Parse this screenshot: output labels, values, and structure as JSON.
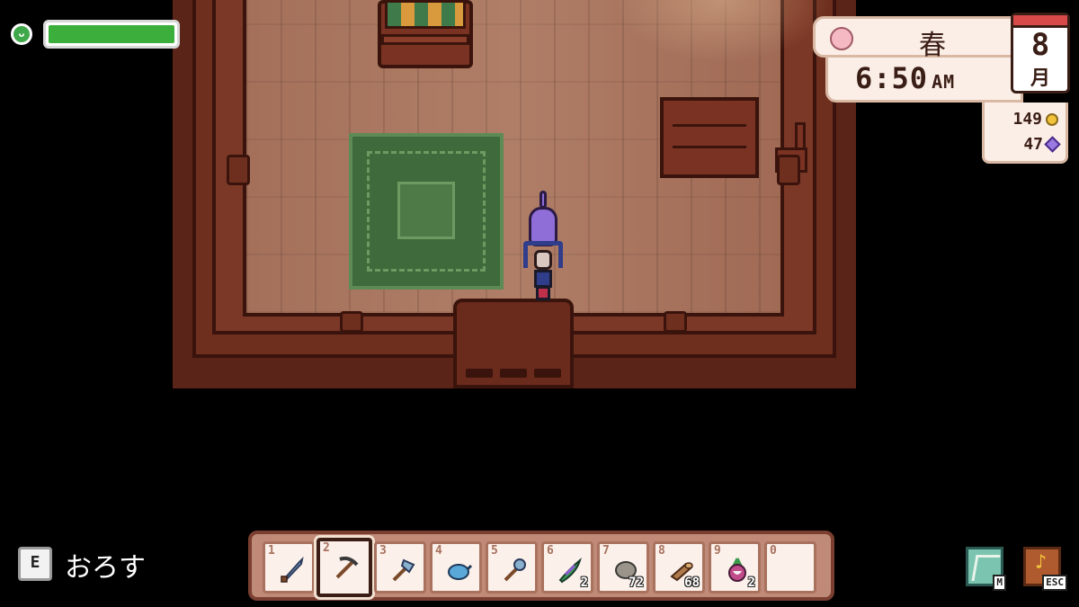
{
  "hud": {
    "health": {
      "fraction": 1.0,
      "icon": "health-icon",
      "color": "#3cae3c"
    },
    "season": "春",
    "time": {
      "clock": "6:50",
      "ampm": "AM"
    },
    "calendar": {
      "day": "8",
      "month": "月"
    },
    "currency": {
      "gold": "149",
      "gems": "47"
    },
    "action": {
      "key": "E",
      "label": "おろす"
    },
    "buttons": {
      "map_key": "M",
      "menu_key": "ESC"
    }
  },
  "hotbar": {
    "selected_index": 1,
    "slots": [
      {
        "num": "1",
        "item": "sword-icon",
        "count": ""
      },
      {
        "num": "2",
        "item": "pickaxe-icon",
        "count": ""
      },
      {
        "num": "3",
        "item": "axe-icon",
        "count": ""
      },
      {
        "num": "4",
        "item": "watering-can-icon",
        "count": ""
      },
      {
        "num": "5",
        "item": "shovel-icon",
        "count": ""
      },
      {
        "num": "6",
        "item": "seaweed-icon",
        "count": "2"
      },
      {
        "num": "7",
        "item": "stone-icon",
        "count": "72"
      },
      {
        "num": "8",
        "item": "wood-icon",
        "count": "68"
      },
      {
        "num": "9",
        "item": "turnip-icon",
        "count": "2"
      },
      {
        "num": "0",
        "item": "",
        "count": ""
      }
    ]
  }
}
